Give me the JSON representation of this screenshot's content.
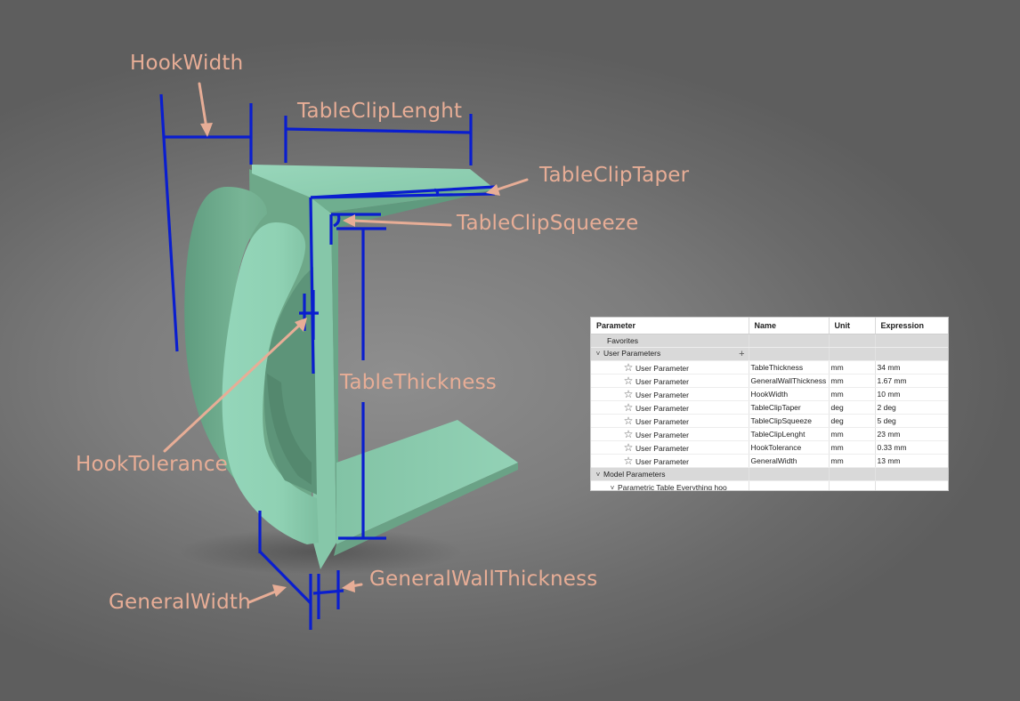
{
  "dimensions": [
    {
      "id": "hook-width",
      "label": "HookWidth"
    },
    {
      "id": "table-clip-lenght",
      "label": "TableClipLenght"
    },
    {
      "id": "table-clip-taper",
      "label": "TableClipTaper"
    },
    {
      "id": "table-clip-squeeze",
      "label": "TableClipSqueeze"
    },
    {
      "id": "table-thickness",
      "label": "TableThickness"
    },
    {
      "id": "hook-tolerance",
      "label": "HookTolerance"
    },
    {
      "id": "general-width",
      "label": "GeneralWidth"
    },
    {
      "id": "general-wall-thickness",
      "label": "GeneralWallThickness"
    }
  ],
  "colors": {
    "label": "#e7ad96",
    "dimension_line": "#0a1ecf",
    "part_green": "#8ccdb0",
    "background": "#7d7d7d"
  },
  "param_table": {
    "headers": {
      "parameter": "Parameter",
      "name": "Name",
      "unit": "Unit",
      "expression": "Expression"
    },
    "favorites_label": "Favorites",
    "user_params_label": "User Parameters",
    "add_icon": "plus-icon",
    "rows": [
      {
        "parameter": "User Parameter",
        "name": "TableThickness",
        "unit": "mm",
        "expression": "34 mm"
      },
      {
        "parameter": "User Parameter",
        "name": "GeneralWallThickness",
        "unit": "mm",
        "expression": "1.67 mm"
      },
      {
        "parameter": "User Parameter",
        "name": "HookWidth",
        "unit": "mm",
        "expression": "10 mm"
      },
      {
        "parameter": "User Parameter",
        "name": "TableClipTaper",
        "unit": "deg",
        "expression": "2 deg"
      },
      {
        "parameter": "User Parameter",
        "name": "TableClipSqueeze",
        "unit": "deg",
        "expression": "5 deg"
      },
      {
        "parameter": "User Parameter",
        "name": "TableClipLenght",
        "unit": "mm",
        "expression": "23 mm"
      },
      {
        "parameter": "User Parameter",
        "name": "HookTolerance",
        "unit": "mm",
        "expression": "0.33 mm"
      },
      {
        "parameter": "User Parameter",
        "name": "GeneralWidth",
        "unit": "mm",
        "expression": "13 mm"
      }
    ],
    "model_params_label": "Model Parameters",
    "model_sub_label": "Parametric Table Everything hoo"
  }
}
